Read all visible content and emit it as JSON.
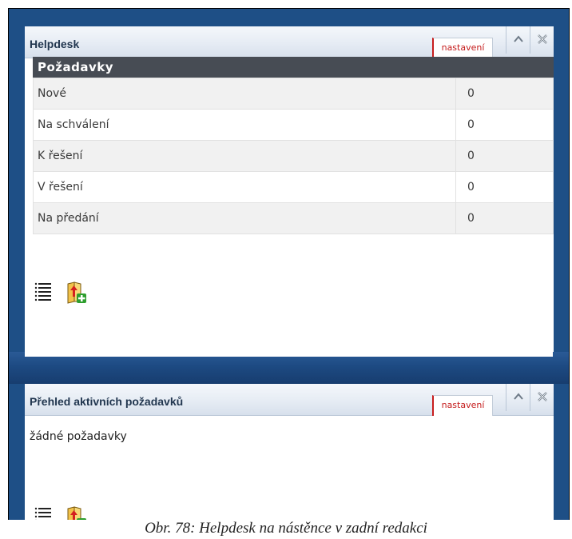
{
  "portlet1": {
    "title": "Helpdesk",
    "settings_label": "nastavení",
    "collapse_icon": "chevron-up-icon",
    "close_icon": "close-icon",
    "section_title": "Požadavky",
    "rows": [
      {
        "label": "Nové",
        "value": "0"
      },
      {
        "label": "Na schválení",
        "value": "0"
      },
      {
        "label": "K řešení",
        "value": "0"
      },
      {
        "label": "V řešení",
        "value": "0"
      },
      {
        "label": "Na předání",
        "value": "0"
      }
    ]
  },
  "portlet2": {
    "title": "Přehled aktivních požadavků",
    "settings_label": "nastavení",
    "collapse_icon": "chevron-up-icon",
    "close_icon": "close-icon",
    "empty_text": "žádné požadavky"
  },
  "colors": {
    "frame_blue": "#1e4f86",
    "section_header": "#474c54",
    "settings_text": "#c41a1a"
  },
  "caption": "Obr. 78: Helpdesk na nástěnce v zadní redakci"
}
